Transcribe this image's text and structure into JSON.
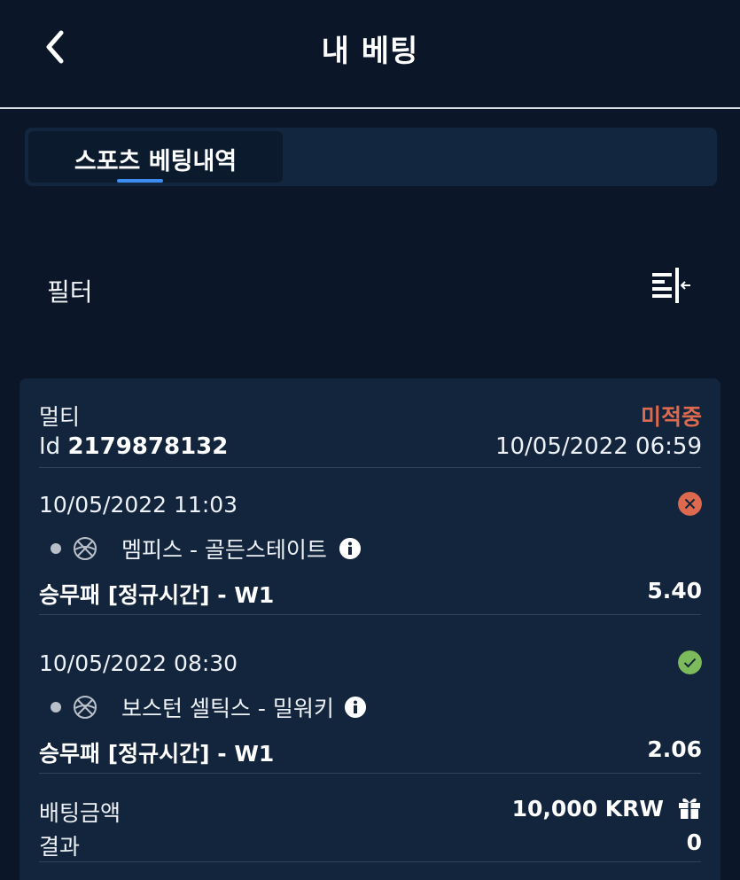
{
  "header": {
    "title": "내 베팅"
  },
  "tabs": [
    {
      "label": "스포츠 베팅내역"
    }
  ],
  "filter": {
    "label": "필터"
  },
  "bet": {
    "type": "멀티",
    "status": "미적중",
    "id_prefix": "Id",
    "id": "2179878132",
    "datetime": "10/05/2022 06:59",
    "selections": [
      {
        "date": "10/05/2022 11:03",
        "result_icon": "lost-x-icon",
        "sport_icon": "basketball-icon",
        "match": "멤피스 - 골든스테이트",
        "market": "승무패 [정규시간] - W1",
        "odds": "5.40"
      },
      {
        "date": "10/05/2022 08:30",
        "result_icon": "won-check-icon",
        "sport_icon": "basketball-icon",
        "match": "보스턴 셀틱스 - 밀워키",
        "market": "승무패 [정규시간] - W1",
        "odds": "2.06"
      }
    ],
    "stake_label": "배팅금액",
    "stake_value": "10,000 KRW",
    "result_label": "결과",
    "result_value": "0"
  },
  "colors": {
    "background": "#0b1729",
    "card": "#13253d",
    "lost": "#dd6a4f",
    "won": "#7cba5c",
    "accent": "#3d8ef0"
  }
}
